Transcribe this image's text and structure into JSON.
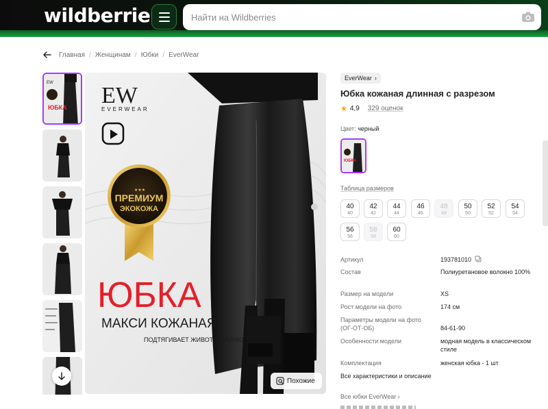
{
  "header": {
    "logo": "wildberries",
    "search_placeholder": "Найти на Wildberries"
  },
  "breadcrumbs": [
    "Главная",
    "Женщинам",
    "Юбки",
    "EverWear"
  ],
  "gallery": {
    "main_image": {
      "brand_logo": "EW",
      "brand_name": "EVERWEAR",
      "badge_line": "ПРЕМИУМ",
      "badge_line2": "ЭКОКОЖА",
      "headline": "ЮБКА",
      "subline": "МАКСИ КОЖАНАЯ",
      "tagline": "ПОДТЯГИВАЕТ ЖИВОТ И ТАЛИЮ",
      "skirt_color": "#1e1e1e",
      "headline_color": "#e3202a"
    },
    "similar_label": "Похожие",
    "thumbs_count": 6
  },
  "product": {
    "brand": "EverWear",
    "title": "Юбка кожаная длинная с разрезом",
    "rating": "4,9",
    "reviews": "329 оценок",
    "color_label": "Цвет:",
    "color_value": "черный",
    "size_table_label": "Таблица размеров",
    "sizes": [
      {
        "ru": "40",
        "intl": "40",
        "available": true
      },
      {
        "ru": "42",
        "intl": "42",
        "available": true
      },
      {
        "ru": "44",
        "intl": "44",
        "available": true
      },
      {
        "ru": "46",
        "intl": "46",
        "available": true
      },
      {
        "ru": "48",
        "intl": "48",
        "available": false
      },
      {
        "ru": "50",
        "intl": "50",
        "available": true
      },
      {
        "ru": "52",
        "intl": "52",
        "available": true
      },
      {
        "ru": "54",
        "intl": "54",
        "available": true
      },
      {
        "ru": "56",
        "intl": "56",
        "available": true
      },
      {
        "ru": "58",
        "intl": "58",
        "available": false
      },
      {
        "ru": "60",
        "intl": "60",
        "available": true
      }
    ],
    "specs": [
      {
        "key": "Артикул",
        "value": "193781010"
      },
      {
        "key": "Состав",
        "value": "Полиуретановое волокно 100%"
      },
      {
        "key": "Размер на модели",
        "value": "XS"
      },
      {
        "key": "Рост модели на фото",
        "value": "174 см"
      },
      {
        "key": "Параметры модели на фото (ОГ-ОТ-ОБ)",
        "value": "84-61-90"
      },
      {
        "key": "Особенности модели",
        "value": "модная модель в классическом стиле"
      },
      {
        "key": "Комплектация",
        "value": "женская юбка - 1 шт"
      }
    ],
    "all_specs_link": "Все характеристики и описание",
    "all_brand_link": "Все юбки EverWear"
  },
  "colors": {
    "accent": "#a73afd",
    "star": "#ff9f10"
  }
}
